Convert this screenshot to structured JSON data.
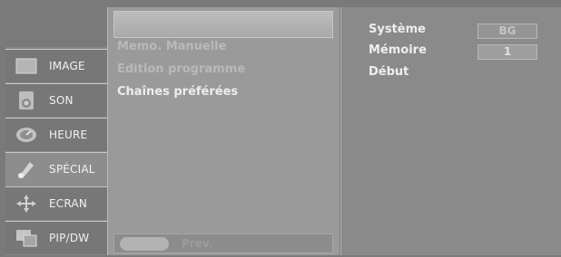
{
  "left_menu": {
    "items": [
      {
        "label": "IMAGE",
        "icon": "picture-icon"
      },
      {
        "label": "SON",
        "icon": "speaker-icon"
      },
      {
        "label": "HEURE",
        "icon": "clock-icon"
      },
      {
        "label": "SPÉCIAL",
        "icon": "special-icon"
      },
      {
        "label": "ECRAN",
        "icon": "screen-arrows-icon"
      },
      {
        "label": "PIP/DW",
        "icon": "pip-icon"
      }
    ]
  },
  "sub_menu": {
    "items": [
      "Memo. Manuelle",
      "Edition programme",
      "Chaînes préférées"
    ],
    "prev_label": "Prev."
  },
  "settings": {
    "system_label": "Système",
    "system_value": "BG",
    "memory_label": "Mémoire",
    "memory_value": "1",
    "start_label": "Début"
  }
}
